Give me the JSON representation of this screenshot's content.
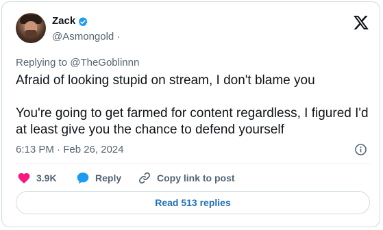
{
  "author": {
    "name": "Zack",
    "handle": "@Asmongold",
    "separator": "·",
    "verified": true
  },
  "replying_to": "Replying to @TheGoblinnn",
  "tweet": {
    "paragraph_1": "Afraid of looking stupid on stream, I don't blame you",
    "paragraph_2": "You're going to get farmed for content regardless, I figured I'd at least give you the chance to defend yourself"
  },
  "timestamp": "6:13 PM · Feb 26, 2024",
  "actions": {
    "like_count": "3.9K",
    "reply_label": "Reply",
    "copy_label": "Copy link to post"
  },
  "read_replies_label": "Read 513 replies",
  "icons": {
    "verified": "verified-badge-icon",
    "logo": "x-logo-icon",
    "info": "info-icon",
    "like": "heart-icon",
    "reply": "speech-bubble-icon",
    "copy": "link-icon"
  },
  "colors": {
    "text_primary": "#0f1419",
    "text_secondary": "#536471",
    "border": "#cfd9de",
    "verified_blue": "#1d9bf0",
    "like_pink": "#f91880",
    "link_blue": "#1d6fb8"
  }
}
